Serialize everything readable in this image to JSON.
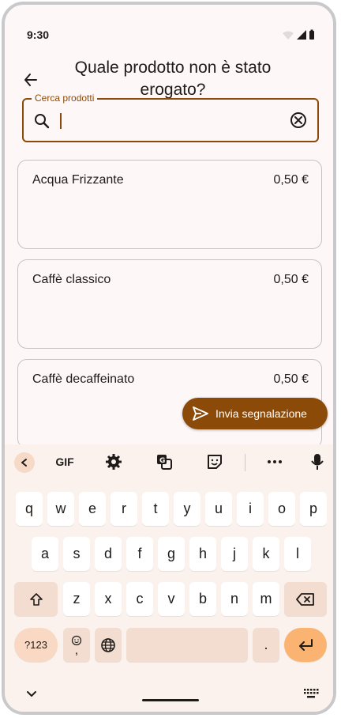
{
  "status_bar": {
    "time": "9:30"
  },
  "header": {
    "title": "Quale prodotto non è stato erogato?"
  },
  "search": {
    "label": "Cerca prodotti",
    "value": ""
  },
  "products": [
    {
      "name": "Acqua Frizzante",
      "price": "0,50 €"
    },
    {
      "name": "Caffè classico",
      "price": "0,50 €"
    },
    {
      "name": "Caffè decaffeinato",
      "price": "0,50 €"
    }
  ],
  "fab": {
    "label": "Invia segnalazione"
  },
  "keyboard": {
    "toolbar": {
      "gif_label": "GIF"
    },
    "row1": [
      "q",
      "w",
      "e",
      "r",
      "t",
      "y",
      "u",
      "i",
      "o",
      "p"
    ],
    "row2": [
      "a",
      "s",
      "d",
      "f",
      "g",
      "h",
      "j",
      "k",
      "l"
    ],
    "row3": [
      "z",
      "x",
      "c",
      "v",
      "b",
      "n",
      "m"
    ],
    "symbols_label": "?123",
    "period_label": ".",
    "emoji_comma_label": ","
  },
  "colors": {
    "accent": "#8b4a08",
    "background": "#fdf8f7",
    "keyboard": "#fbf2ee"
  }
}
